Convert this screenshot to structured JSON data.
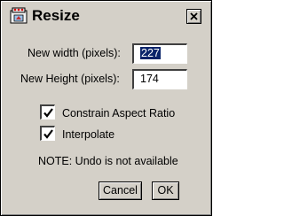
{
  "dialog": {
    "title": "Resize",
    "icon": "paint-palette-icon",
    "close_icon": "close-icon"
  },
  "fields": {
    "width_label": "New width (pixels):",
    "width_value": "227",
    "height_label": "New Height (pixels):",
    "height_value": "174"
  },
  "options": {
    "constrain_label": "Constrain Aspect Ratio",
    "constrain_checked": true,
    "interpolate_label": "Interpolate",
    "interpolate_checked": true
  },
  "note": "NOTE: Undo is not available",
  "buttons": {
    "cancel_label": "Cancel",
    "ok_label": "OK"
  },
  "colors": {
    "face": "#d4d0c8",
    "selection": "#0a246a"
  }
}
